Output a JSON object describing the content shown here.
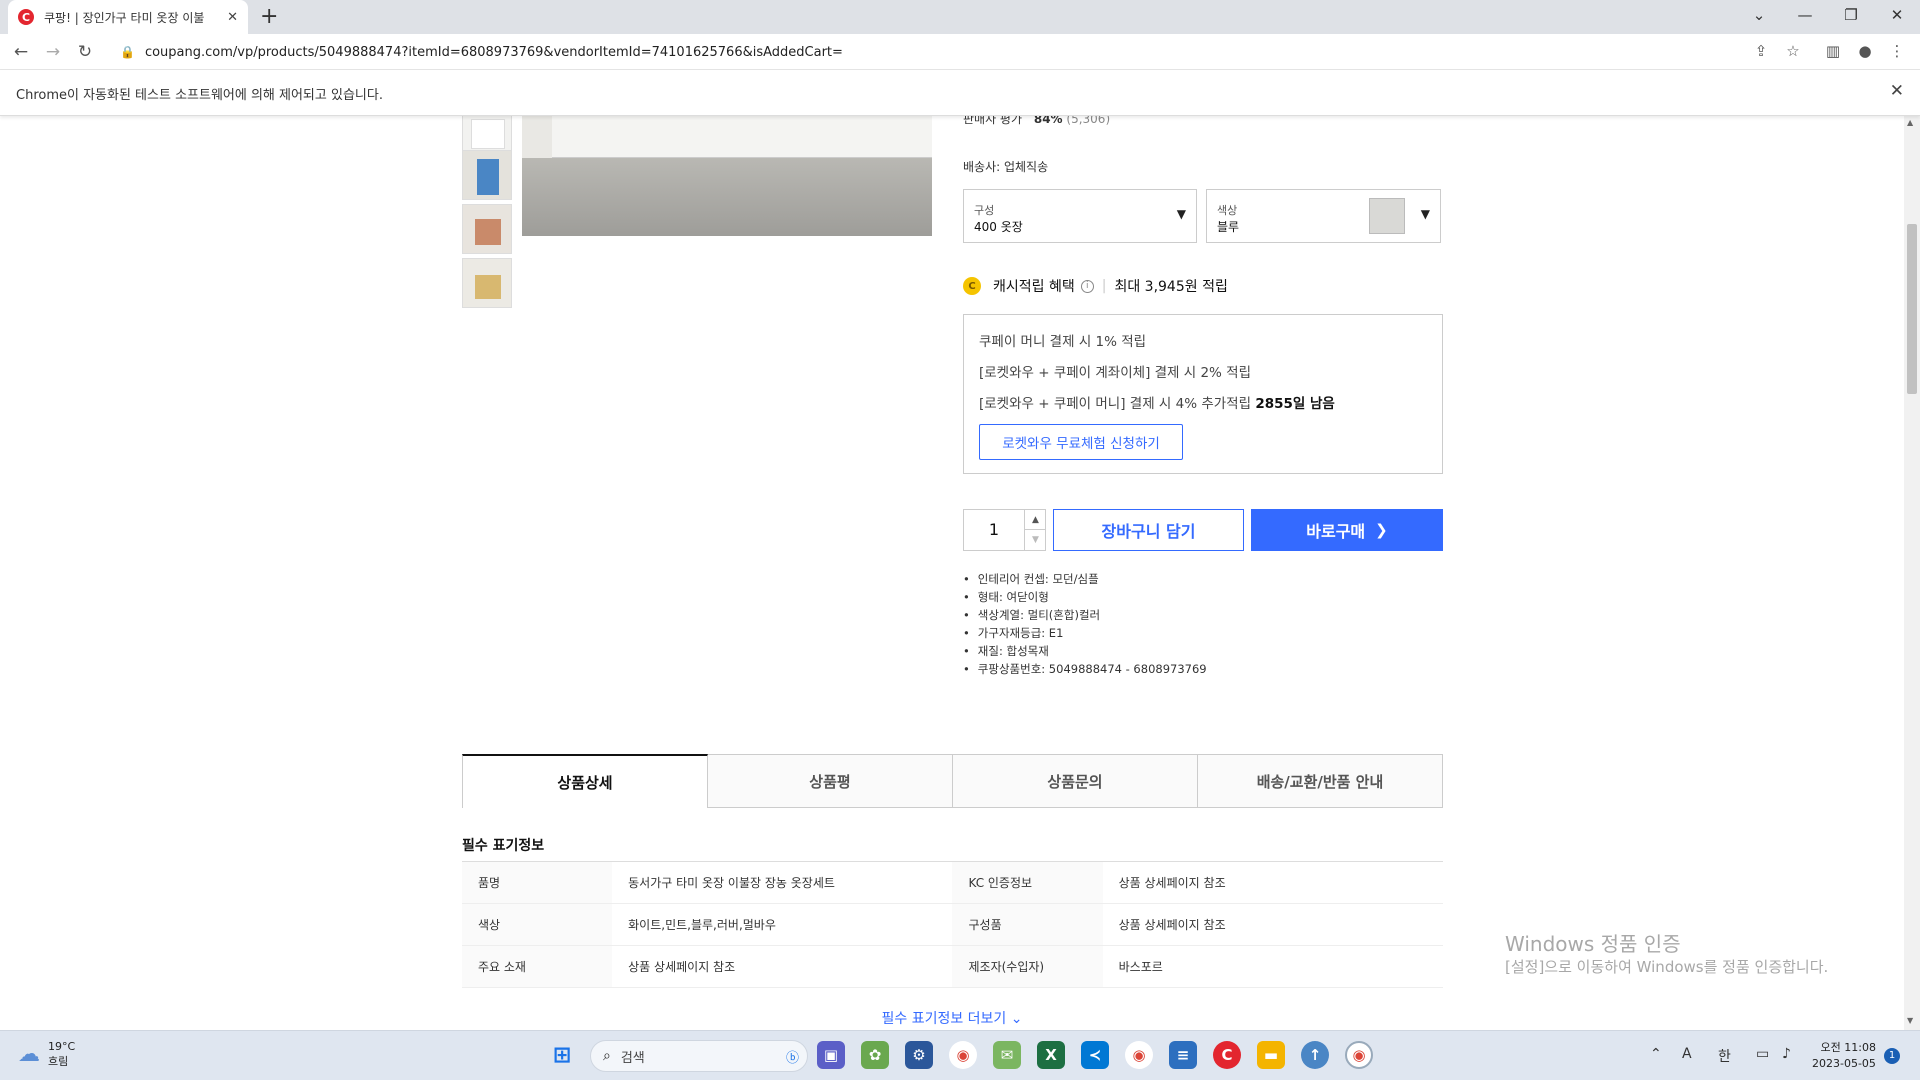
{
  "browser": {
    "tab_title": "쿠팡! | 장인가구 타미 옷장 이불",
    "tab_favicon": "C",
    "url": "coupang.com/vp/products/5049888474?itemId=6808973769&vendorItemId=74101625766&isAddedCart=",
    "infobar_message": "Chrome이 자동화된 테스트 소프트웨어에 의해 제어되고 있습니다.",
    "icons": [
      "back-arrow-icon",
      "forward-arrow-icon",
      "reload-icon",
      "lock-icon",
      "share-icon",
      "star-icon",
      "sidepanel-icon",
      "profile-icon",
      "menu-icon"
    ]
  },
  "product": {
    "seller_rating_label": "판매자 평가",
    "seller_rating_value": "84%",
    "seller_rating_count": "(5,306)",
    "delivery_label": "배송사: 업체직송",
    "option1": {
      "key": "구성",
      "value": "400 옷장"
    },
    "option2": {
      "key": "색상",
      "value": "블루"
    },
    "cash_label": "캐시적립 혜택",
    "cash_max": "최대 3,945원 적립",
    "cash_lines": [
      {
        "text": "쿠페이 머니 결제 시 1% 적립",
        "bold": ""
      },
      {
        "text": "[로켓와우 + 쿠페이 계좌이체] 결제 시 2% 적립",
        "bold": ""
      },
      {
        "text": "[로켓와우 + 쿠페이 머니] 결제 시 4% 추가적립 ",
        "bold": "2855일 남음"
      }
    ],
    "trial_button": "로켓와우 무료체험 신청하기",
    "quantity": "1",
    "cart_button": "장바구니 담기",
    "buy_button": "바로구매",
    "attributes": [
      "인테리어 컨셉: 모던/심플",
      "형태: 여닫이형",
      "색상계열: 멀티(혼합)컬러",
      "가구자재등급: E1",
      "재질: 합성목재",
      "쿠팡상품번호: 5049888474 - 6808973769"
    ]
  },
  "tabs": [
    "상품상세",
    "상품평",
    "상품문의",
    "배송/교환/반품 안내"
  ],
  "required_info": {
    "title": "필수 표기정보",
    "rows": [
      [
        "품명",
        "동서가구 타미 옷장 이불장 장농 옷장세트",
        "KC 인증정보",
        "상품 상세페이지 참조"
      ],
      [
        "색상",
        "화이트,민트,블루,러버,멀바우",
        "구성품",
        "상품 상세페이지 참조"
      ],
      [
        "주요 소재",
        "상품 상세페이지 참조",
        "제조자(수입자)",
        "바스포르"
      ]
    ],
    "more_link": "필수 표기정보 더보기"
  },
  "watermark": {
    "line1": "Windows 정품 인증",
    "line2": "[설정]으로 이동하여 Windows를 정품 인증합니다."
  },
  "taskbar": {
    "temperature": "19°C",
    "weather": "흐림",
    "search_placeholder": "검색",
    "ime_a": "A",
    "ime_lang": "한",
    "time": "오전 11:08",
    "date": "2023-05-05",
    "notification_count": "1"
  },
  "colors": {
    "accent_blue": "#346aff",
    "coupang_red": "#e3262f",
    "coin_yellow": "#f5c400"
  }
}
